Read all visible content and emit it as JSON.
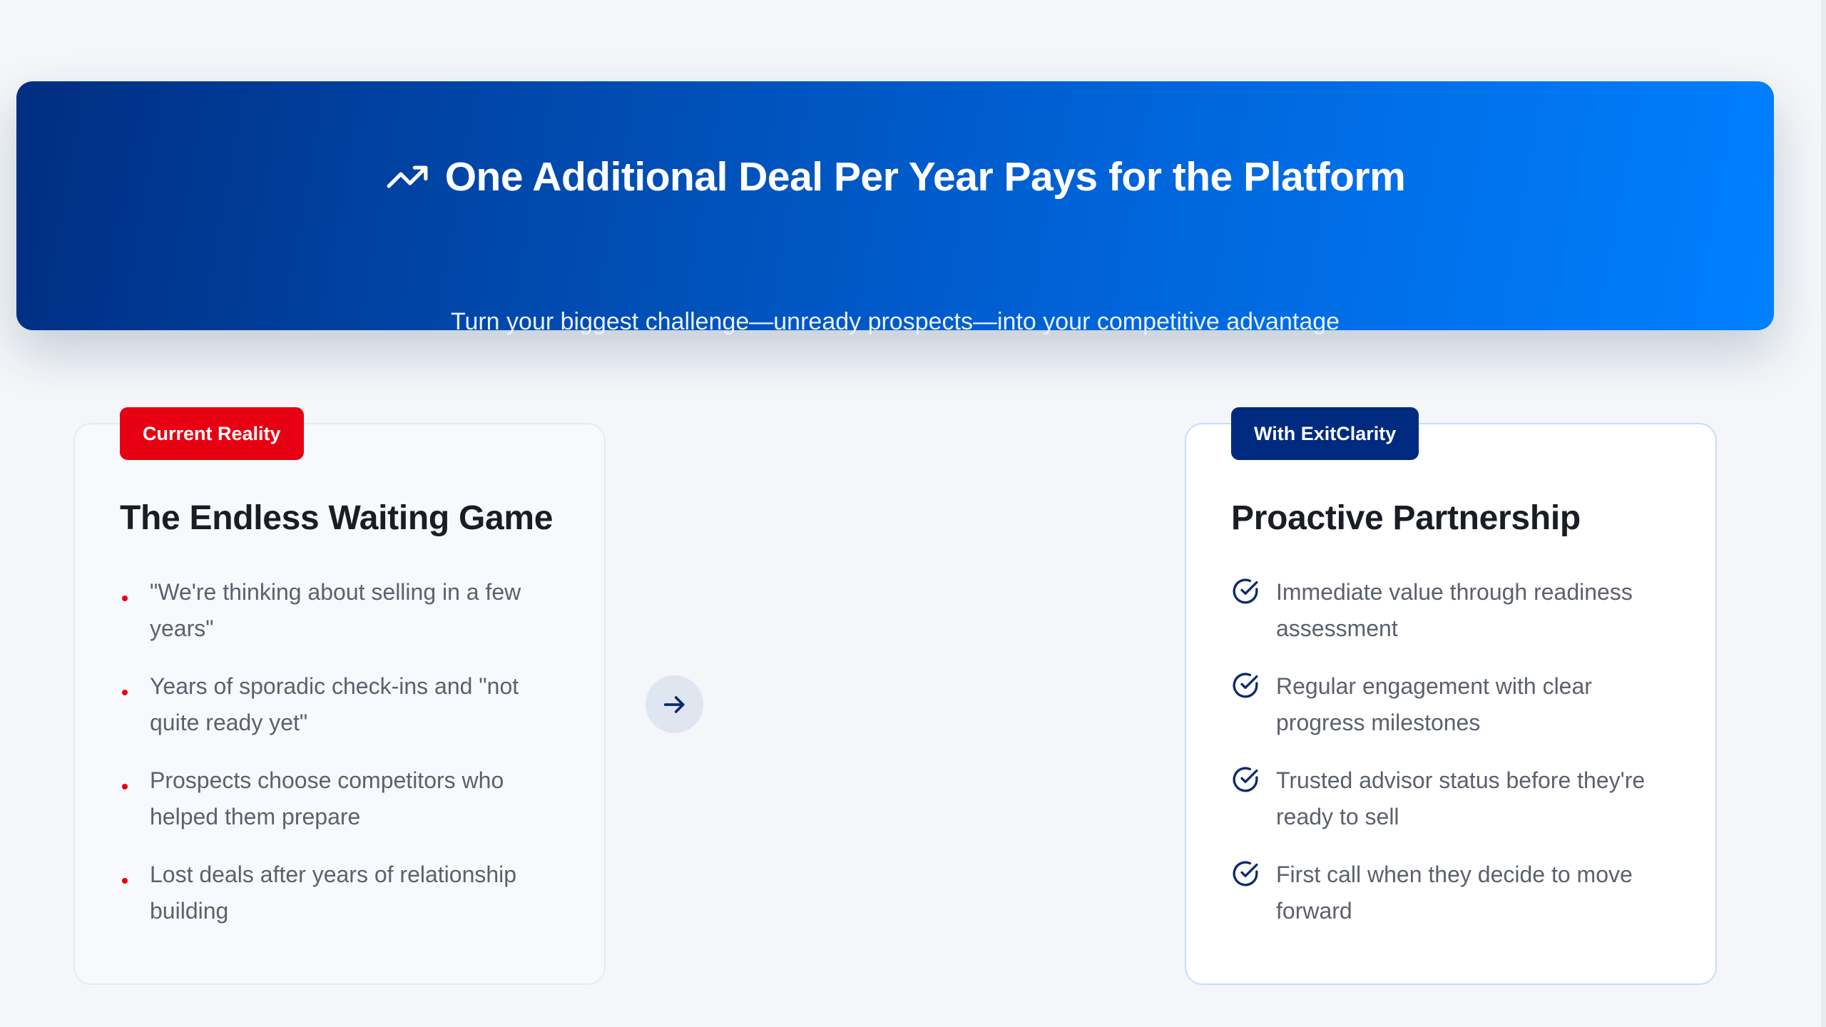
{
  "hero": {
    "icon": "trending-up-icon",
    "title": "One Additional Deal Per Year Pays for the Platform",
    "subtitle": "Turn your biggest challenge—unready prospects—into your competitive advantage"
  },
  "current": {
    "badge": "Current Reality",
    "title": "The Endless Waiting Game",
    "items": [
      "\"We're thinking about selling in a few years\"",
      "Years of sporadic check-ins and \"not quite ready yet\"",
      "Prospects choose competitors who helped them prepare",
      "Lost deals after years of relationship building"
    ]
  },
  "transition": {
    "icon": "arrow-right-icon"
  },
  "future": {
    "badge": "With ExitClarity",
    "title": "Proactive Partnership",
    "items": [
      "Immediate value through readiness assessment",
      "Regular engagement with clear progress milestones",
      "Trusted advisor status before they're ready to sell",
      "First call when they decide to move forward"
    ]
  },
  "colors": {
    "hero_gradient_start": "#002e82",
    "hero_gradient_end": "#0080ff",
    "badge_red": "#e60012",
    "badge_navy": "#002a7f",
    "check_icon": "#0d2a6e"
  }
}
